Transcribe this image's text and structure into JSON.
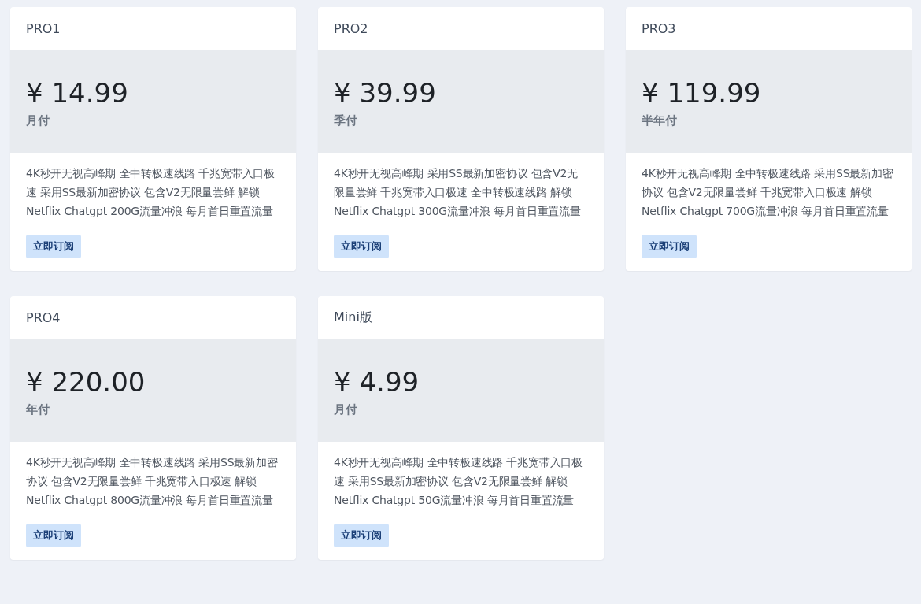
{
  "plans": [
    {
      "name": "PRO1",
      "price": "¥ 14.99",
      "period": "月付",
      "description": "4K秒开无视高峰期 全中转极速线路 千兆宽带入口极速 采用SS最新加密协议 包含V2无限量尝鲜 解锁Netflix Chatgpt 200G流量冲浪 每月首日重置流量",
      "button": "立即订阅"
    },
    {
      "name": "PRO2",
      "price": "¥ 39.99",
      "period": "季付",
      "description": "4K秒开无视高峰期 采用SS最新加密协议 包含V2无限量尝鲜 千兆宽带入口极速 全中转极速线路 解锁Netflix Chatgpt 300G流量冲浪 每月首日重置流量",
      "button": "立即订阅"
    },
    {
      "name": "PRO3",
      "price": "¥ 119.99",
      "period": "半年付",
      "description": "4K秒开无视高峰期 全中转极速线路 采用SS最新加密协议 包含V2无限量尝鲜 千兆宽带入口极速 解锁Netflix Chatgpt 700G流量冲浪 每月首日重置流量",
      "button": "立即订阅"
    },
    {
      "name": "PRO4",
      "price": "¥ 220.00",
      "period": "年付",
      "description": "4K秒开无视高峰期 全中转极速线路 采用SS最新加密协议 包含V2无限量尝鲜 千兆宽带入口极速 解锁Netflix Chatgpt 800G流量冲浪 每月首日重置流量",
      "button": "立即订阅"
    },
    {
      "name": "Mini版",
      "price": "¥ 4.99",
      "period": "月付",
      "description": "4K秒开无视高峰期 全中转极速线路 千兆宽带入口极速 采用SS最新加密协议 包含V2无限量尝鲜 解锁Netflix Chatgpt 50G流量冲浪 每月首日重置流量",
      "button": "立即订阅"
    }
  ]
}
